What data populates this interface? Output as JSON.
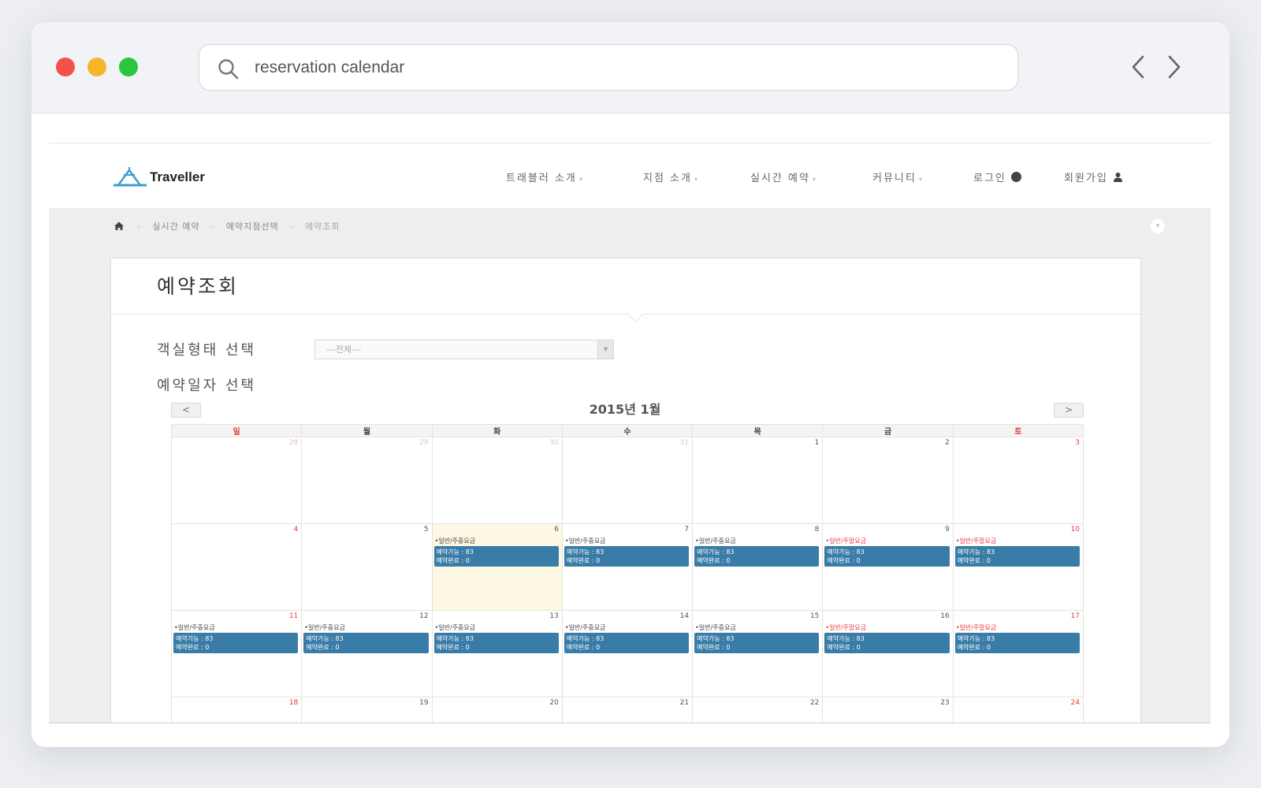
{
  "browser": {
    "search_text": "reservation calendar"
  },
  "site": {
    "logo_text": "Traveller",
    "menu": [
      {
        "label": "트래블러 소개"
      },
      {
        "label": "지점 소개"
      },
      {
        "label": "실시간 예약"
      },
      {
        "label": "커뮤니티"
      },
      {
        "label": "로그인"
      },
      {
        "label": "회원가입"
      }
    ]
  },
  "breadcrumb": {
    "items": [
      "실시간 예약",
      "예약지점선택",
      "예약조회"
    ]
  },
  "panel": {
    "title": "예약조회",
    "room_type_label": "객실형태 선택",
    "room_type_value": "---전체---",
    "date_label": "예약일자 선택"
  },
  "calendar": {
    "title": "2015년 1월",
    "prev_label": "<",
    "next_label": ">",
    "weekdays": [
      "일",
      "월",
      "화",
      "수",
      "목",
      "금",
      "토"
    ],
    "event_weekday": "•일반/주중요금",
    "event_weekend": "•일반/주말요금",
    "available_text": "예약가능 : 83",
    "booked_text": "예약완료 : 0",
    "weeks": [
      [
        {
          "day": "28",
          "muted": true
        },
        {
          "day": "29",
          "muted": true
        },
        {
          "day": "30",
          "muted": true
        },
        {
          "day": "31",
          "muted": true
        },
        {
          "day": "1"
        },
        {
          "day": "2"
        },
        {
          "day": "3"
        }
      ],
      [
        {
          "day": "4"
        },
        {
          "day": "5"
        },
        {
          "day": "6",
          "today": true,
          "event": "weekday"
        },
        {
          "day": "7",
          "event": "weekday"
        },
        {
          "day": "8",
          "event": "weekday"
        },
        {
          "day": "9",
          "event": "weekend"
        },
        {
          "day": "10",
          "event": "weekend"
        }
      ],
      [
        {
          "day": "11",
          "event": "weekday"
        },
        {
          "day": "12",
          "event": "weekday"
        },
        {
          "day": "13",
          "event": "weekday"
        },
        {
          "day": "14",
          "event": "weekday"
        },
        {
          "day": "15",
          "event": "weekday"
        },
        {
          "day": "16",
          "event": "weekend"
        },
        {
          "day": "17",
          "event": "weekend"
        }
      ],
      [
        {
          "day": "18"
        },
        {
          "day": "19"
        },
        {
          "day": "20"
        },
        {
          "day": "21"
        },
        {
          "day": "22"
        },
        {
          "day": "23"
        },
        {
          "day": "24"
        }
      ]
    ]
  },
  "colors": {
    "event_box": "#3a7ca8",
    "weekend_red": "#e43c3c",
    "today_bg": "#fcf8e3"
  }
}
